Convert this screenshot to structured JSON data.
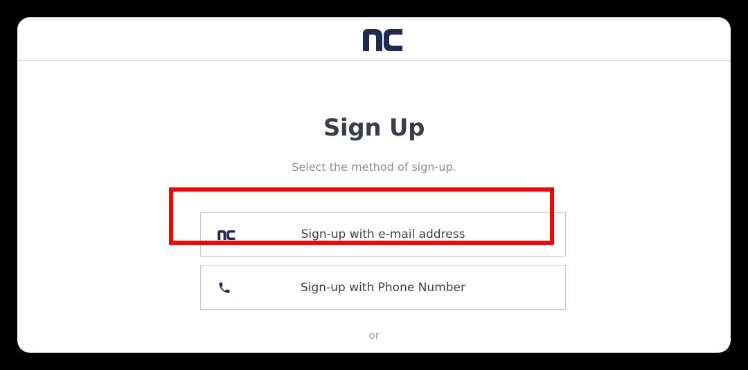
{
  "header": {
    "logo_text": "nc"
  },
  "main": {
    "title": "Sign Up",
    "subtitle": "Select the method of sign-up.",
    "methods": [
      {
        "label": "Sign-up with e-mail address",
        "icon": "nc-logo-icon"
      },
      {
        "label": "Sign-up with Phone Number",
        "icon": "phone-icon"
      }
    ],
    "divider_text": "or"
  },
  "colors": {
    "brand_navy": "#1f2a52",
    "highlight": "#ff0000",
    "text_primary": "#3a3d4a",
    "text_secondary": "#8a8c93"
  }
}
